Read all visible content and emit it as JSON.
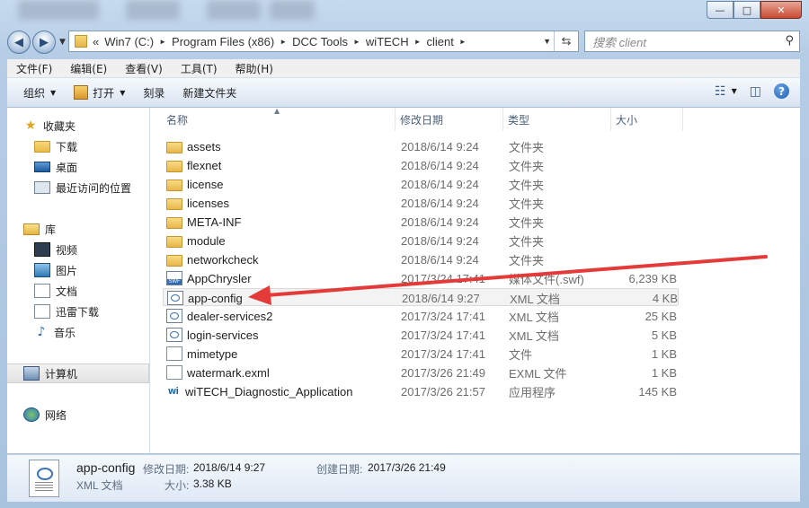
{
  "window": {
    "caption_buttons": [
      "—",
      "□",
      "✕"
    ]
  },
  "address": {
    "prefix": "«",
    "segments": [
      "Win7 (C:)",
      "Program Files (x86)",
      "DCC Tools",
      "wiTECH",
      "client"
    ]
  },
  "search": {
    "placeholder": "搜索 client"
  },
  "menu": [
    "文件(F)",
    "编辑(E)",
    "查看(V)",
    "工具(T)",
    "帮助(H)"
  ],
  "commands": {
    "organize": "组织",
    "open": "打开",
    "burn": "刻录",
    "new_folder": "新建文件夹"
  },
  "nav": {
    "favorites": "收藏夹",
    "downloads": "下载",
    "desktop": "桌面",
    "recent": "最近访问的位置",
    "libraries": "库",
    "videos": "视频",
    "pictures": "图片",
    "documents": "文档",
    "thunder": "迅雷下载",
    "music": "音乐",
    "computer": "计算机",
    "network": "网络"
  },
  "columns": {
    "name": "名称",
    "date": "修改日期",
    "type": "类型",
    "size": "大小"
  },
  "files": [
    {
      "name": "assets",
      "date": "2018/6/14 9:24",
      "type": "文件夹",
      "size": "",
      "icon": "folder-icon"
    },
    {
      "name": "flexnet",
      "date": "2018/6/14 9:24",
      "type": "文件夹",
      "size": "",
      "icon": "folder-icon"
    },
    {
      "name": "license",
      "date": "2018/6/14 9:24",
      "type": "文件夹",
      "size": "",
      "icon": "folder-icon"
    },
    {
      "name": "licenses",
      "date": "2018/6/14 9:24",
      "type": "文件夹",
      "size": "",
      "icon": "folder-icon"
    },
    {
      "name": "META-INF",
      "date": "2018/6/14 9:24",
      "type": "文件夹",
      "size": "",
      "icon": "folder-icon"
    },
    {
      "name": "module",
      "date": "2018/6/14 9:24",
      "type": "文件夹",
      "size": "",
      "icon": "folder-icon"
    },
    {
      "name": "networkcheck",
      "date": "2018/6/14 9:24",
      "type": "文件夹",
      "size": "",
      "icon": "folder-icon"
    },
    {
      "name": "AppChrysler",
      "date": "2017/3/24 17:41",
      "type": "媒体文件(.swf)",
      "size": "6,239 KB",
      "icon": "swf-file-icon"
    },
    {
      "name": "app-config",
      "date": "2018/6/14 9:27",
      "type": "XML 文档",
      "size": "4 KB",
      "icon": "xml-file-icon",
      "selected": true
    },
    {
      "name": "dealer-services2",
      "date": "2017/3/24 17:41",
      "type": "XML 文档",
      "size": "25 KB",
      "icon": "xml-file-icon"
    },
    {
      "name": "login-services",
      "date": "2017/3/24 17:41",
      "type": "XML 文档",
      "size": "5 KB",
      "icon": "xml-file-icon"
    },
    {
      "name": "mimetype",
      "date": "2017/3/24 17:41",
      "type": "文件",
      "size": "1 KB",
      "icon": "file-icon"
    },
    {
      "name": "watermark.exml",
      "date": "2017/3/26 21:49",
      "type": "EXML 文件",
      "size": "1 KB",
      "icon": "file-icon"
    },
    {
      "name": "wiTECH_Diagnostic_Application",
      "date": "2017/3/26 21:57",
      "type": "应用程序",
      "size": "145 KB",
      "icon": "app-icon"
    }
  ],
  "details": {
    "name": "app-config",
    "type": "XML 文档",
    "modified_label": "修改日期:",
    "modified": "2018/6/14 9:27",
    "created_label": "创建日期:",
    "created": "2017/3/26 21:49",
    "size_label": "大小:",
    "size": "3.38 KB"
  },
  "annotation": {
    "arrow_color": "#e53a3a"
  }
}
